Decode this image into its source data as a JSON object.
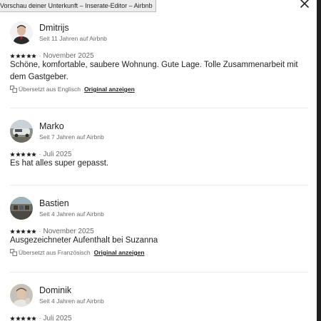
{
  "window": {
    "tooltip": "Vorschau deiner Unterkunft – Inserate-Editor – Airbnb"
  },
  "colors": {
    "text_primary": "#222222",
    "text_secondary": "#6a6a6a",
    "divider": "#ebebeb",
    "star": "#222222"
  },
  "close_icon": "close-icon",
  "reviews": [
    {
      "name": "Dmitrijs",
      "since": "Seit 11 Jahren auf Airbnb",
      "rating": 5,
      "separator": "·",
      "date": "November 2025",
      "text": "Schöne, komfortable, saubere Wohnung. Gute Lage. Tolle Zusammenarbeit mit dem Gastgeber.",
      "translation_note": "Übersetzt aus Englisch",
      "original_link": "Original anzeigen"
    },
    {
      "name": "Marko",
      "since": "Seit 7 Jahren auf Airbnb",
      "rating": 5,
      "separator": "·",
      "date": "Juli 2025",
      "text": "Es hat alles super gepasst."
    },
    {
      "name": "Bastien",
      "since": "Seit 4 Jahren auf Airbnb",
      "rating": 5,
      "separator": "·",
      "date": "November 2025",
      "text": "Ausgezeichneter Aufenthalt bei Suzanna",
      "translation_note": "Übersetzt aus Französisch",
      "original_link": "Original anzeigen"
    },
    {
      "name": "Dominik",
      "since": "Seit 4 Jahren auf Airbnb",
      "rating": 5,
      "separator": "·",
      "date": "Juli 2025"
    }
  ]
}
